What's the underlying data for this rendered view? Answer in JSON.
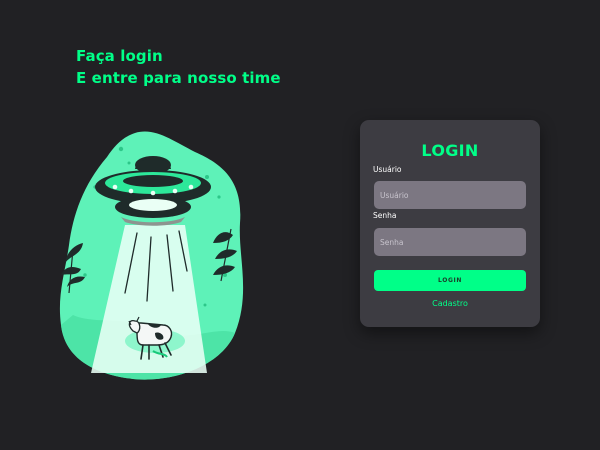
{
  "headline": {
    "line1": "Faça login",
    "line2": "E entre para nosso time"
  },
  "illustration": {
    "icon": "ufo-abducting-cow-illustration"
  },
  "login_card": {
    "title": "LOGIN",
    "username": {
      "label": "Usuário",
      "placeholder": "Usuário",
      "value": ""
    },
    "password": {
      "label": "Senha",
      "placeholder": "Senha",
      "value": ""
    },
    "submit_label": "LOGIN",
    "signup_link": "Cadastro"
  },
  "colors": {
    "background": "#212124",
    "accent": "#00ff88",
    "card": "#3d3c42",
    "input": "#7c7782"
  }
}
